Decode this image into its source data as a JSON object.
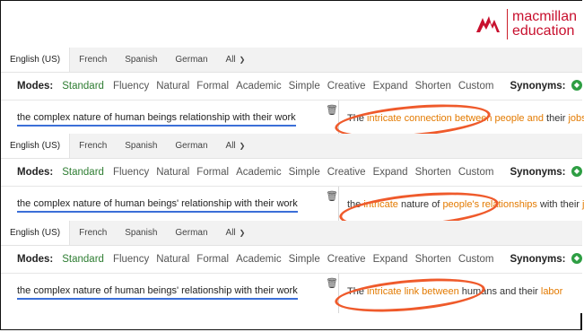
{
  "brand": {
    "name_line1": "macmillan",
    "name_line2": "education",
    "color": "#c8102e"
  },
  "languages": [
    "English (US)",
    "French",
    "Spanish",
    "German",
    "All"
  ],
  "modes": {
    "label": "Modes:",
    "items": [
      "Standard",
      "Fluency",
      "Natural",
      "Formal",
      "Academic",
      "Simple",
      "Creative",
      "Expand",
      "Shorten",
      "Custom"
    ],
    "active": "Standard"
  },
  "synonyms": {
    "label": "Synonyms:",
    "level": 0.3
  },
  "colors": {
    "accent": "#2e7d32",
    "highlight": "#e37a00",
    "underline": "#3b6fd8",
    "circle": "#ef5a2b"
  },
  "panels": [
    {
      "input": "the complex nature of human beings relationship with their work",
      "output": [
        {
          "text": "The ",
          "hl": false
        },
        {
          "text": "intricate connection between",
          "hl": true
        },
        {
          "text": " ",
          "hl": false
        },
        {
          "text": "people and",
          "hl": true
        },
        {
          "text": " their ",
          "hl": false
        },
        {
          "text": "jobs",
          "hl": true
        }
      ]
    },
    {
      "input": "the complex nature of human beings' relationship with their work",
      "output": [
        {
          "text": "the ",
          "hl": false
        },
        {
          "text": "intricate",
          "hl": true
        },
        {
          "text": " nature of ",
          "hl": false
        },
        {
          "text": "people's relationships",
          "hl": true
        },
        {
          "text": " with their ",
          "hl": false
        },
        {
          "text": "jobs",
          "hl": true
        }
      ]
    },
    {
      "input": "the complex nature of human beings' relationship with their work",
      "output": [
        {
          "text": "The ",
          "hl": false
        },
        {
          "text": "intricate link between",
          "hl": true
        },
        {
          "text": " humans and their ",
          "hl": false
        },
        {
          "text": "labor",
          "hl": true
        }
      ]
    }
  ]
}
